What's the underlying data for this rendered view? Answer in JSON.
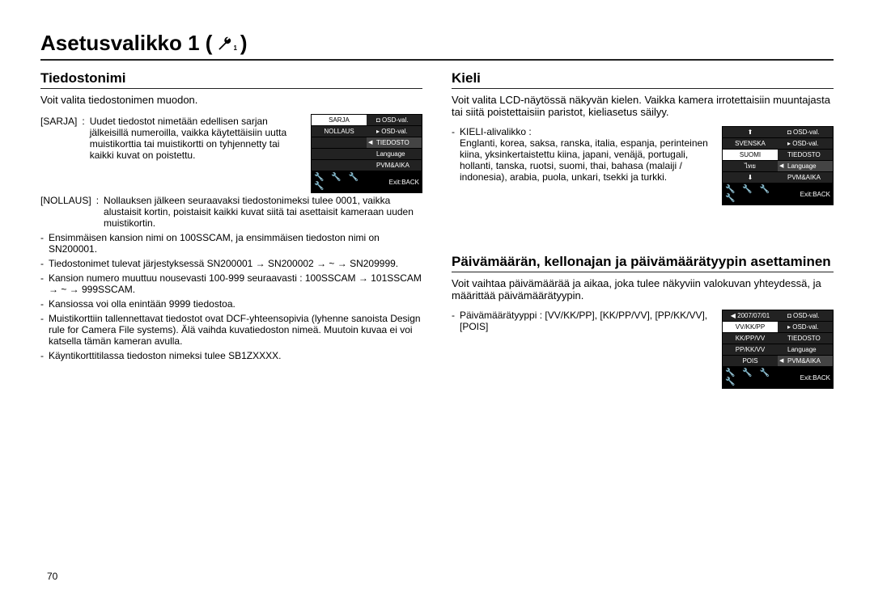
{
  "page_title_prefix": "Asetusvalikko 1 (",
  "page_title_suffix": ")",
  "page_number": "70",
  "left": {
    "section_title": "Tiedostonimi",
    "lead": "Voit valita tiedostonimen muodon.",
    "defs": [
      {
        "term": "[SARJA]",
        "sep": ":",
        "desc": "Uudet tiedostot nimetään edellisen sarjan jälkeisillä numeroilla, vaikka käytettäisiin uutta muistikorttia tai muistikortti on tyhjennetty tai kaikki kuvat on poistettu."
      },
      {
        "term": "[NOLLAUS]",
        "sep": ":",
        "desc": "Nollauksen jälkeen seuraavaksi tiedostonimeksi tulee 0001, vaikka alustaisit kortin, poistaisit kaikki kuvat siitä tai asettaisit kameraan uuden muistikortin."
      }
    ],
    "bullets": [
      "Ensimmäisen kansion nimi on 100SSCAM, ja ensimmäisen tiedoston nimi on SN200001.",
      "Tiedostonimet tulevat järjestyksessä SN200001 → SN200002 → ~ → SN209999.",
      "Kansion numero muuttuu nousevasti 100-999 seuraavasti : 100SSCAM → 101SSCAM → ~ → 999SSCAM.",
      "Kansiossa voi olla enintään 9999 tiedostoa.",
      "Muistikorttiin tallennettavat tiedostot ovat DCF-yhteensopivia (lyhenne sanoista Design rule for Camera File systems). Älä vaihda kuvatiedoston nimeä. Muutoin kuvaa ei voi katsella tämän kameran avulla.",
      "Käyntikorttitilassa tiedoston nimeksi tulee SB1ZXXXX."
    ],
    "lcd": {
      "rows": [
        {
          "l": "SARJA",
          "r": "OSD-val.",
          "sel": "l",
          "ricon": "camera"
        },
        {
          "l": "NOLLAUS",
          "r": "OSD-val.",
          "ricon": "play"
        },
        {
          "l": "",
          "r": "TIEDOSTO",
          "arrow": true,
          "sel": "r"
        },
        {
          "l": "",
          "r": "Language"
        },
        {
          "l": "",
          "r": "PVM&AIKA"
        }
      ],
      "exit": "Exit:BACK"
    }
  },
  "right1": {
    "section_title": "Kieli",
    "lead": "Voit valita LCD-näytössä näkyvän kielen. Vaikka kamera irrotettaisiin muuntajasta tai siitä poistettaisiin paristot, kieliasetus säilyy.",
    "sub_label": "KIELI-alivalikko :",
    "sub_text": "Englanti, korea, saksa, ranska, italia, espanja, perinteinen kiina, yksinkertaistettu kiina, japani, venäjä, portugali, hollanti, tanska, ruotsi, suomi, thai, bahasa (malaiji / indonesia), arabia, puola, unkari, tsekki ja turkki.",
    "lcd": {
      "rows": [
        {
          "l": "⬆",
          "r": "OSD-val.",
          "ricon": "camera"
        },
        {
          "l": "SVENSKA",
          "r": "OSD-val.",
          "ricon": "play"
        },
        {
          "l": "SUOMI",
          "r": "TIEDOSTO",
          "sel": "l"
        },
        {
          "l": "ไทย",
          "r": "Language",
          "arrow": true,
          "sel": "r"
        },
        {
          "l": "⬇",
          "r": "PVM&AIKA"
        }
      ],
      "exit": "Exit:BACK"
    }
  },
  "right2": {
    "section_title": "Päivämäärän, kellonajan ja päivämäärätyypin asettaminen",
    "lead": "Voit vaihtaa päivämäärää ja aikaa, joka tulee näkyviin valokuvan yhteydessä, ja määrittää päivämäärätyypin.",
    "sub_label": "Päivämäärätyyppi :",
    "sub_text": "[VV/KK/PP], [KK/PP/VV], [PP/KK/VV], [POIS]",
    "lcd": {
      "rows": [
        {
          "l": "2007/07/01",
          "r": "OSD-val.",
          "larrow": true,
          "ricon": "camera"
        },
        {
          "l": "VV/KK/PP",
          "r": "OSD-val.",
          "sel": "l",
          "ricon": "play"
        },
        {
          "l": "KK/PP/VV",
          "r": "TIEDOSTO"
        },
        {
          "l": "PP/KK/VV",
          "r": "Language"
        },
        {
          "l": "POIS",
          "r": "PVM&AIKA",
          "arrow": true,
          "sel": "r"
        }
      ],
      "exit": "Exit:BACK"
    }
  }
}
